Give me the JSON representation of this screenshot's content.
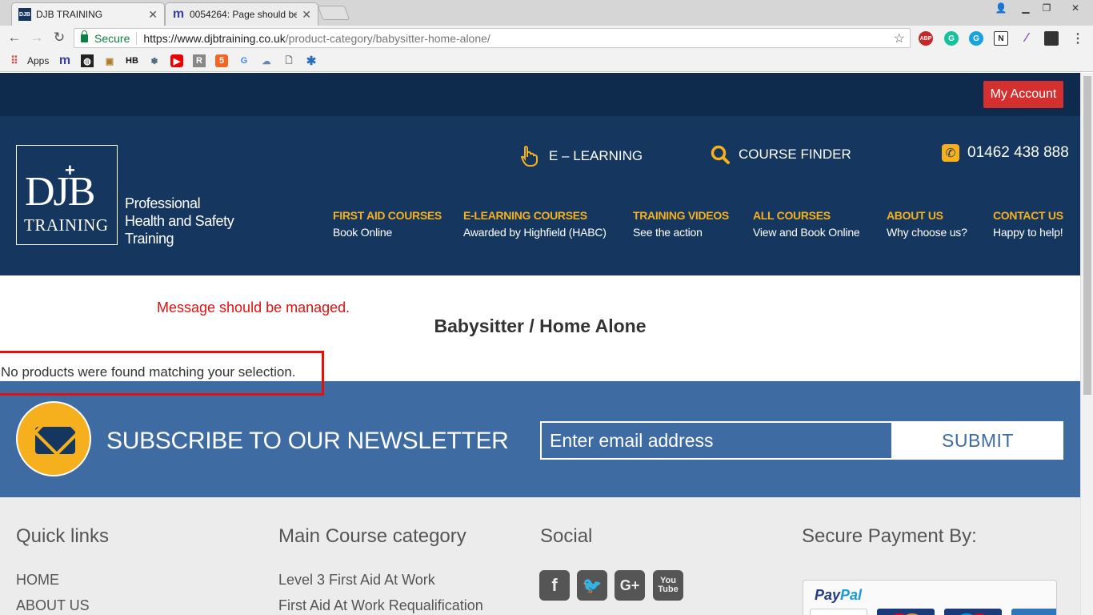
{
  "browser": {
    "tabs": [
      {
        "title": "DJB TRAINING",
        "favicon": "djb-favicon",
        "active": true
      },
      {
        "title": "0054264: Page should be",
        "favicon": "mantis-favicon",
        "active": false
      }
    ],
    "secure_label": "Secure",
    "url_host": "https://www.djbtraining.co.uk",
    "url_path": "/product-category/babysitter-home-alone/",
    "bookmarks_apps_label": "Apps"
  },
  "topbar": {
    "my_account": "My Account"
  },
  "header": {
    "logo_djb": "DJB",
    "logo_training": "TRAINING",
    "tagline": [
      "Professional",
      "Health and Safety",
      "Training"
    ],
    "elearning": "E – LEARNING",
    "course_finder": "COURSE FINDER",
    "phone": "01462 438 888",
    "nav": [
      {
        "title": "FIRST AID COURSES",
        "sub": "Book Online"
      },
      {
        "title": "E-LEARNING COURSES",
        "sub": "Awarded by Highfield (HABC)"
      },
      {
        "title": "TRAINING VIDEOS",
        "sub": "See the action"
      },
      {
        "title": "ALL COURSES",
        "sub": "View and Book Online"
      },
      {
        "title": "ABOUT US",
        "sub": "Why choose us?"
      },
      {
        "title": "CONTACT US",
        "sub": "Happy to help!"
      }
    ]
  },
  "content": {
    "annotation": "Message should be managed.",
    "page_title": "Babysitter / Home Alone",
    "no_products": "No products were found matching your selection."
  },
  "newsletter": {
    "heading": "SUBSCRIBE TO OUR NEWSLETTER",
    "email_placeholder": "Enter email address",
    "submit": "SUBMIT"
  },
  "footer": {
    "quick_links_title": "Quick links",
    "quick_links": [
      "HOME",
      "ABOUT US"
    ],
    "main_category_title": "Main Course category",
    "main_category_links": [
      "Level 3 First Aid At Work",
      "First Aid At Work Requalification"
    ],
    "social_title": "Social",
    "social_icons": [
      "facebook-icon",
      "twitter-icon",
      "google-plus-icon",
      "youtube-icon"
    ],
    "payment_title": "Secure Payment By:",
    "paypal_label": "PayPal"
  },
  "colors": {
    "topbar": "#0e2b4e",
    "header": "#15375f",
    "accent_yellow": "#f6b01e",
    "account_red": "#d3302f",
    "newsletter_blue": "#3d6ba2",
    "annotation_red": "#e0120f"
  }
}
